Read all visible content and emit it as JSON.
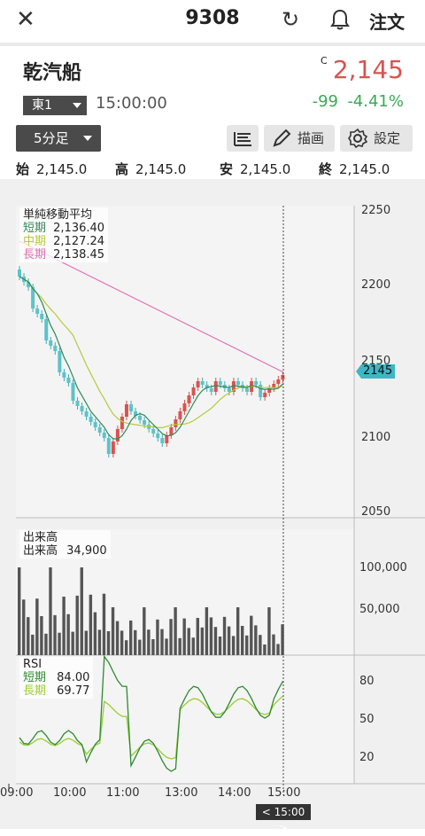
{
  "header": {
    "stock_code": "9308",
    "order_label": "注文",
    "icons": {
      "close": "close-icon",
      "reload": "reload-icon",
      "bell": "bell-icon"
    }
  },
  "quote": {
    "name": "乾汽船",
    "market": "東1",
    "time": "15:00:00",
    "flag": "C",
    "price": "2,145",
    "change": "-99",
    "change_pct": "-4.41%",
    "colors": {
      "up": "#d9534f",
      "down": "#3aaa55"
    }
  },
  "toolbar": {
    "period": "5分足",
    "draw_label": "描画",
    "settings_label": "設定"
  },
  "ohlc": {
    "open_label": "始",
    "open": "2,145.0",
    "high_label": "高",
    "high": "2,145.0",
    "low_label": "安",
    "low": "2,145.0",
    "close_label": "終",
    "close": "2,145.0"
  },
  "chart": {
    "ma_title": "単純移動平均",
    "ma": [
      {
        "label": "短期",
        "value": "2,136.40",
        "color": "#2e8b57"
      },
      {
        "label": "中期",
        "value": "2,127.24",
        "color": "#b8c93a"
      },
      {
        "label": "長期",
        "value": "2,138.45",
        "color": "#e070b0"
      }
    ],
    "price_ticks": [
      "2250",
      "2200",
      "2150",
      "2100",
      "2050"
    ],
    "last_price_tag": "2145",
    "volume_title": "出来高",
    "volume_label": "出来高",
    "volume_value": "34,900",
    "volume_ticks": [
      "100,000",
      "50,000"
    ],
    "rsi_title": "RSI",
    "rsi": [
      {
        "label": "短期",
        "value": "84.00",
        "color": "#2e8b2e"
      },
      {
        "label": "長期",
        "value": "69.77",
        "color": "#9acd32"
      }
    ],
    "rsi_ticks": [
      "80",
      "50",
      "20"
    ],
    "x_ticks": [
      "09:00",
      "10:00",
      "11:00",
      "13:00",
      "14:00",
      "15:00"
    ],
    "cursor_label": "< 15:00 >"
  },
  "chart_data": {
    "type": "line",
    "title": "",
    "xlabel": "",
    "ylabel": "",
    "ylim": [
      2050,
      2250
    ],
    "x": [
      "09:00",
      "10:00",
      "11:00",
      "13:00",
      "14:00",
      "15:00"
    ],
    "series": [
      {
        "name": "短期",
        "last": 2136.4
      },
      {
        "name": "中期",
        "last": 2127.24
      },
      {
        "name": "長期",
        "last": 2138.45
      }
    ]
  }
}
